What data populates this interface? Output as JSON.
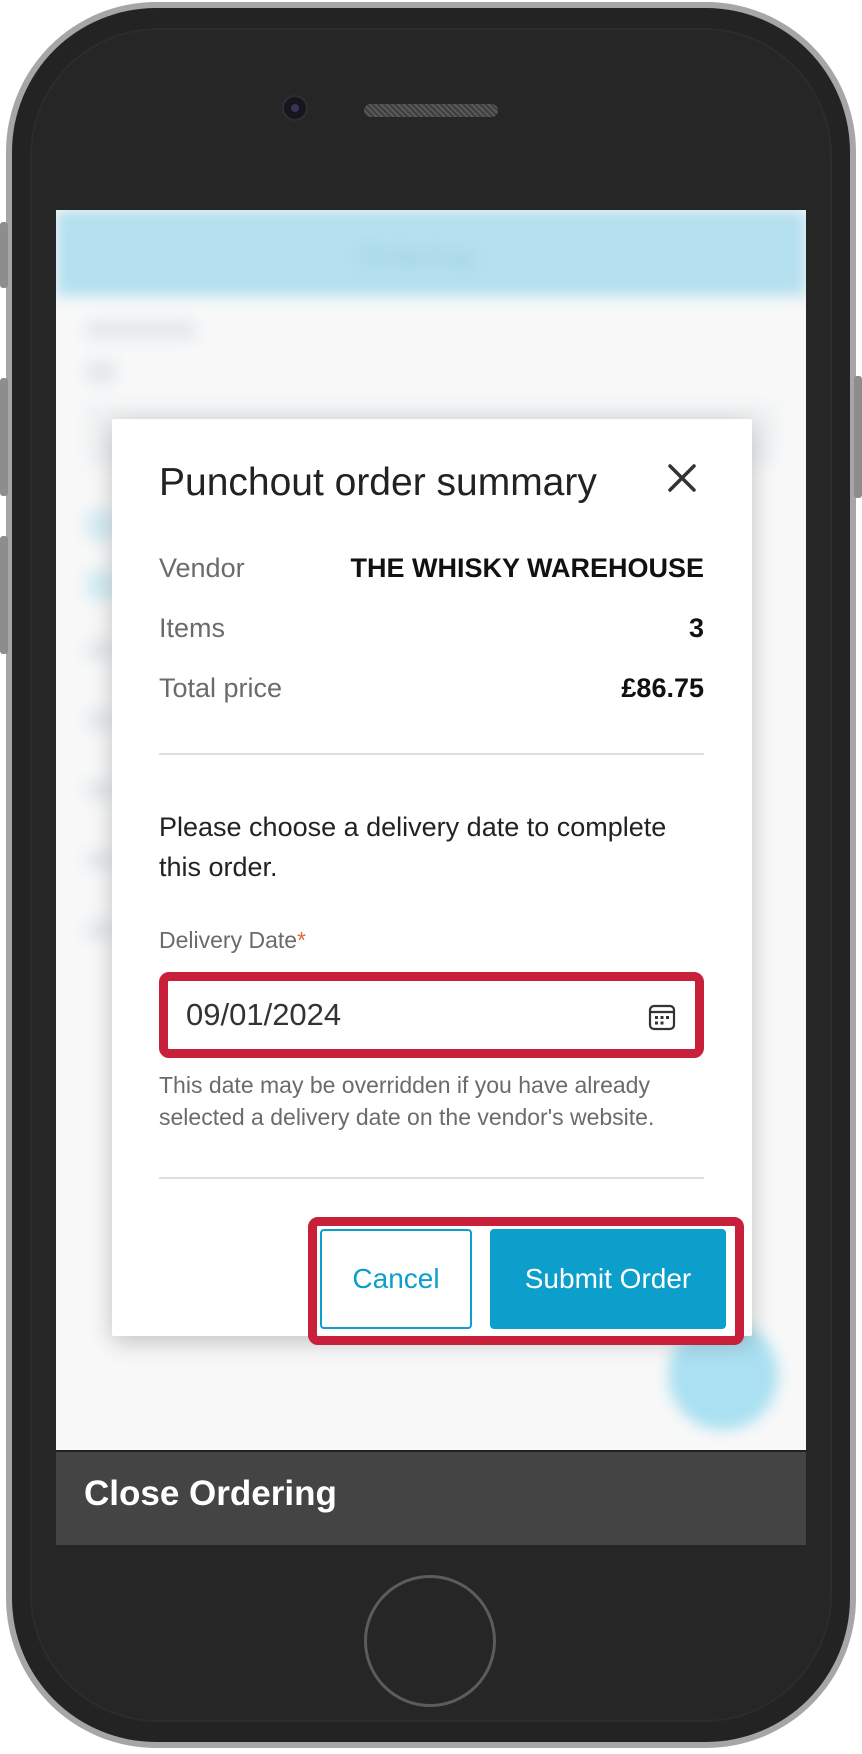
{
  "background_app": {
    "header_title": "Ordering"
  },
  "modal": {
    "title": "Punchout order summary",
    "summary": [
      {
        "label": "Vendor",
        "value": "THE WHISKY WAREHOUSE"
      },
      {
        "label": "Items",
        "value": "3"
      },
      {
        "label": "Total price",
        "value": "£86.75"
      }
    ],
    "instruction": "Please choose a delivery date to complete this order.",
    "delivery_date": {
      "label": "Delivery Date",
      "required_marker": "*",
      "value": "09/01/2024",
      "helper_text": "This date may be overridden if you have already selected a delivery date on the vendor's website."
    },
    "buttons": {
      "cancel": "Cancel",
      "submit": "Submit Order"
    }
  },
  "bottom_bar": {
    "label": "Close Ordering"
  },
  "colors": {
    "accent": "#0c9fcc",
    "highlight": "#c8203b",
    "required": "#e06c3a",
    "header_bg": "#8ccfe6",
    "bottom_bar_bg": "#444444"
  },
  "icons": {
    "close": "close-icon",
    "calendar": "calendar-icon"
  }
}
